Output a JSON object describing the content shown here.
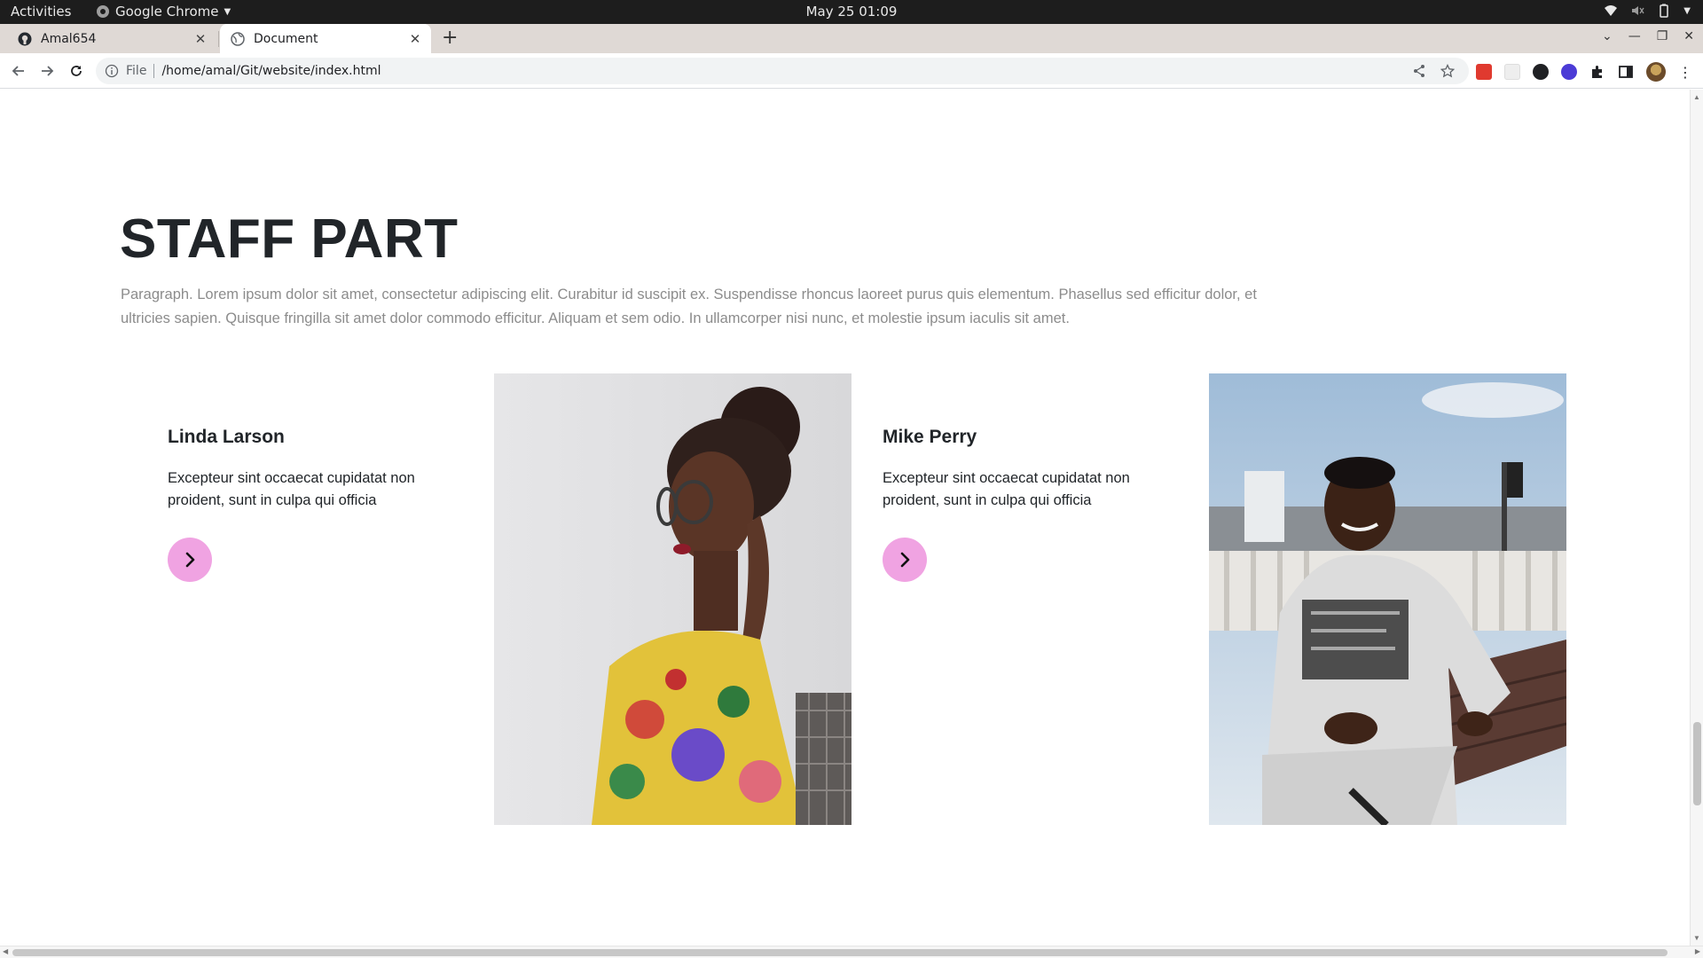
{
  "system_bar": {
    "activities": "Activities",
    "app_name": "Google Chrome",
    "clock": "May 25  01:09"
  },
  "browser": {
    "tabs": [
      {
        "title": "Amal654",
        "icon": "github-icon",
        "active": false
      },
      {
        "title": "Document",
        "icon": "globe-icon",
        "active": true
      }
    ],
    "address": {
      "scheme": "File",
      "url": "/home/amal/Git/website/index.html"
    }
  },
  "page": {
    "section_title": "STAFF PART",
    "section_paragraph": "Paragraph. Lorem ipsum dolor sit amet, consectetur adipiscing elit. Curabitur id suscipit ex. Suspendisse rhoncus laoreet purus quis elementum. Phasellus sed efficitur dolor, et ultricies sapien. Quisque fringilla sit amet dolor commodo efficitur. Aliquam et sem odio. In ullamcorper nisi nunc, et molestie ipsum iaculis sit amet.",
    "staff": [
      {
        "name": "Linda Larson",
        "description": "Excepteur sint occaecat cupidatat non proident, sunt in culpa qui officia"
      },
      {
        "name": "Mike Perry",
        "description": "Excepteur sint occaecat cupidatat non proident, sunt in culpa qui officia"
      }
    ],
    "accent_color": "#f0a3e2"
  }
}
